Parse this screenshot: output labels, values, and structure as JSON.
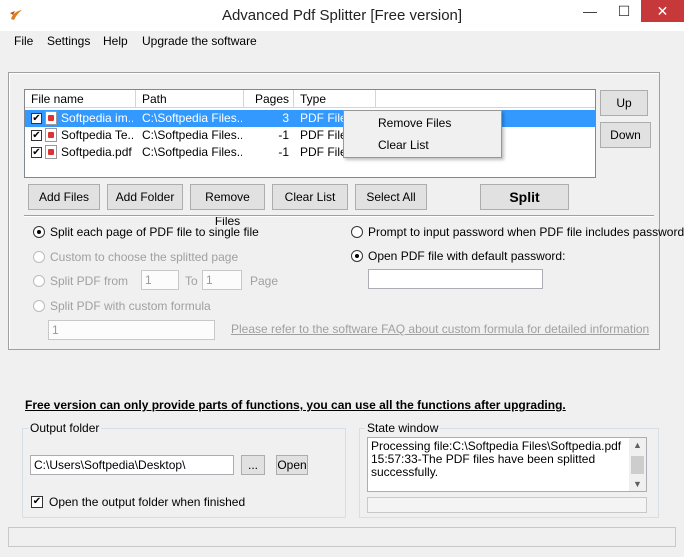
{
  "window": {
    "title": "Advanced Pdf Splitter [Free version]",
    "minimize": "—",
    "maximize": "☐",
    "close": "✕"
  },
  "menu": [
    "File",
    "Settings",
    "Help",
    "Upgrade the software"
  ],
  "list": {
    "columns": [
      "File name",
      "Path",
      "Pages",
      "Type"
    ],
    "rows": [
      {
        "name": "Softpedia im...",
        "path": "C:\\Softpedia Files...",
        "pages": "3",
        "type": "PDF File",
        "checked": true,
        "selected": true
      },
      {
        "name": "Softpedia Te...",
        "path": "C:\\Softpedia Files...",
        "pages": "-1",
        "type": "PDF File",
        "checked": true,
        "selected": false
      },
      {
        "name": "Softpedia.pdf",
        "path": "C:\\Softpedia Files...",
        "pages": "-1",
        "type": "PDF File",
        "checked": true,
        "selected": false
      }
    ]
  },
  "side_buttons": {
    "up": "Up",
    "down": "Down"
  },
  "context_menu": [
    "Remove Files",
    "Clear List"
  ],
  "buttons": {
    "add_files": "Add Files",
    "add_folder": "Add Folder",
    "remove_files": "Remove Files",
    "clear_list": "Clear List",
    "select_all": "Select All",
    "split": "Split"
  },
  "options": {
    "split_each": "Split each page of PDF file to single file",
    "custom_choose": "Custom to choose the splitted page",
    "split_from": "Split PDF from",
    "from_value": "1",
    "to_label": "To",
    "to_value": "1",
    "page_label": "Page",
    "custom_formula": "Split PDF with custom formula",
    "formula_value": "1",
    "faq_link": "Please refer to the software FAQ about custom formula for detailed information",
    "prompt_password": "Prompt to input password when PDF file includes password",
    "default_password": "Open PDF file with default password:",
    "password_value": ""
  },
  "notice": "Free version can only provide parts of functions, you can use all the functions after upgrading.",
  "output": {
    "group_title": "Output folder",
    "path": "C:\\Users\\Softpedia\\Desktop\\",
    "browse": "...",
    "open": "Open",
    "open_when_finished": "Open the output folder when finished"
  },
  "state": {
    "group_title": "State window",
    "text": "Processing file:C:\\Softpedia Files\\Softpedia.pdf 15:57:33-The PDF files have been splitted successfully."
  },
  "colors": {
    "selection": "#3399ff",
    "close_button": "#c7383b",
    "window_bg": "#f0f0f0"
  }
}
